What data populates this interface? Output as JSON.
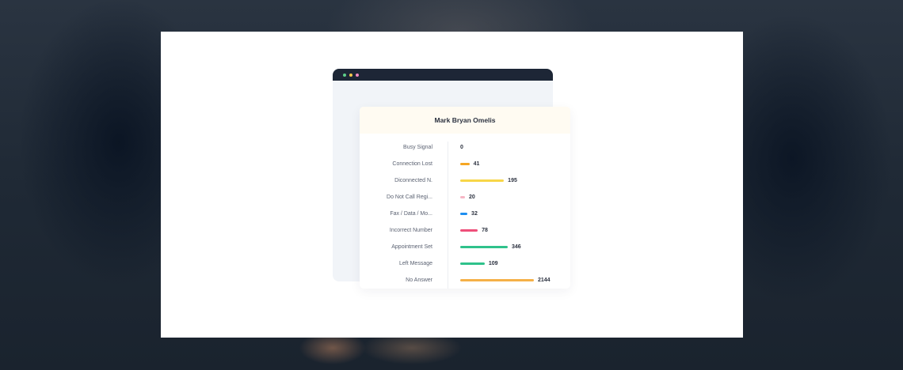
{
  "window": {
    "dots": [
      "#5ed08a",
      "#f5c84c",
      "#f08ac2"
    ]
  },
  "panel": {
    "title": "Mark Bryan Omelis"
  },
  "chart_data": {
    "type": "bar",
    "orientation": "horizontal",
    "categories": [
      "Busy Signal",
      "Connection Lost",
      "Diconnected N.",
      "Do Not Call Regi...",
      "Fax / Data / Mo...",
      "Incorrect Number",
      "Appointment Set",
      "Left Message",
      "No Answer"
    ],
    "values": [
      0,
      41,
      195,
      20,
      32,
      78,
      346,
      109,
      2144
    ],
    "colors": [
      "#f5a623",
      "#f5a623",
      "#f8d648",
      "#f6b6c5",
      "#1e8ef0",
      "#ee4f7a",
      "#2fc28b",
      "#2fc28b",
      "#f5b048"
    ]
  }
}
